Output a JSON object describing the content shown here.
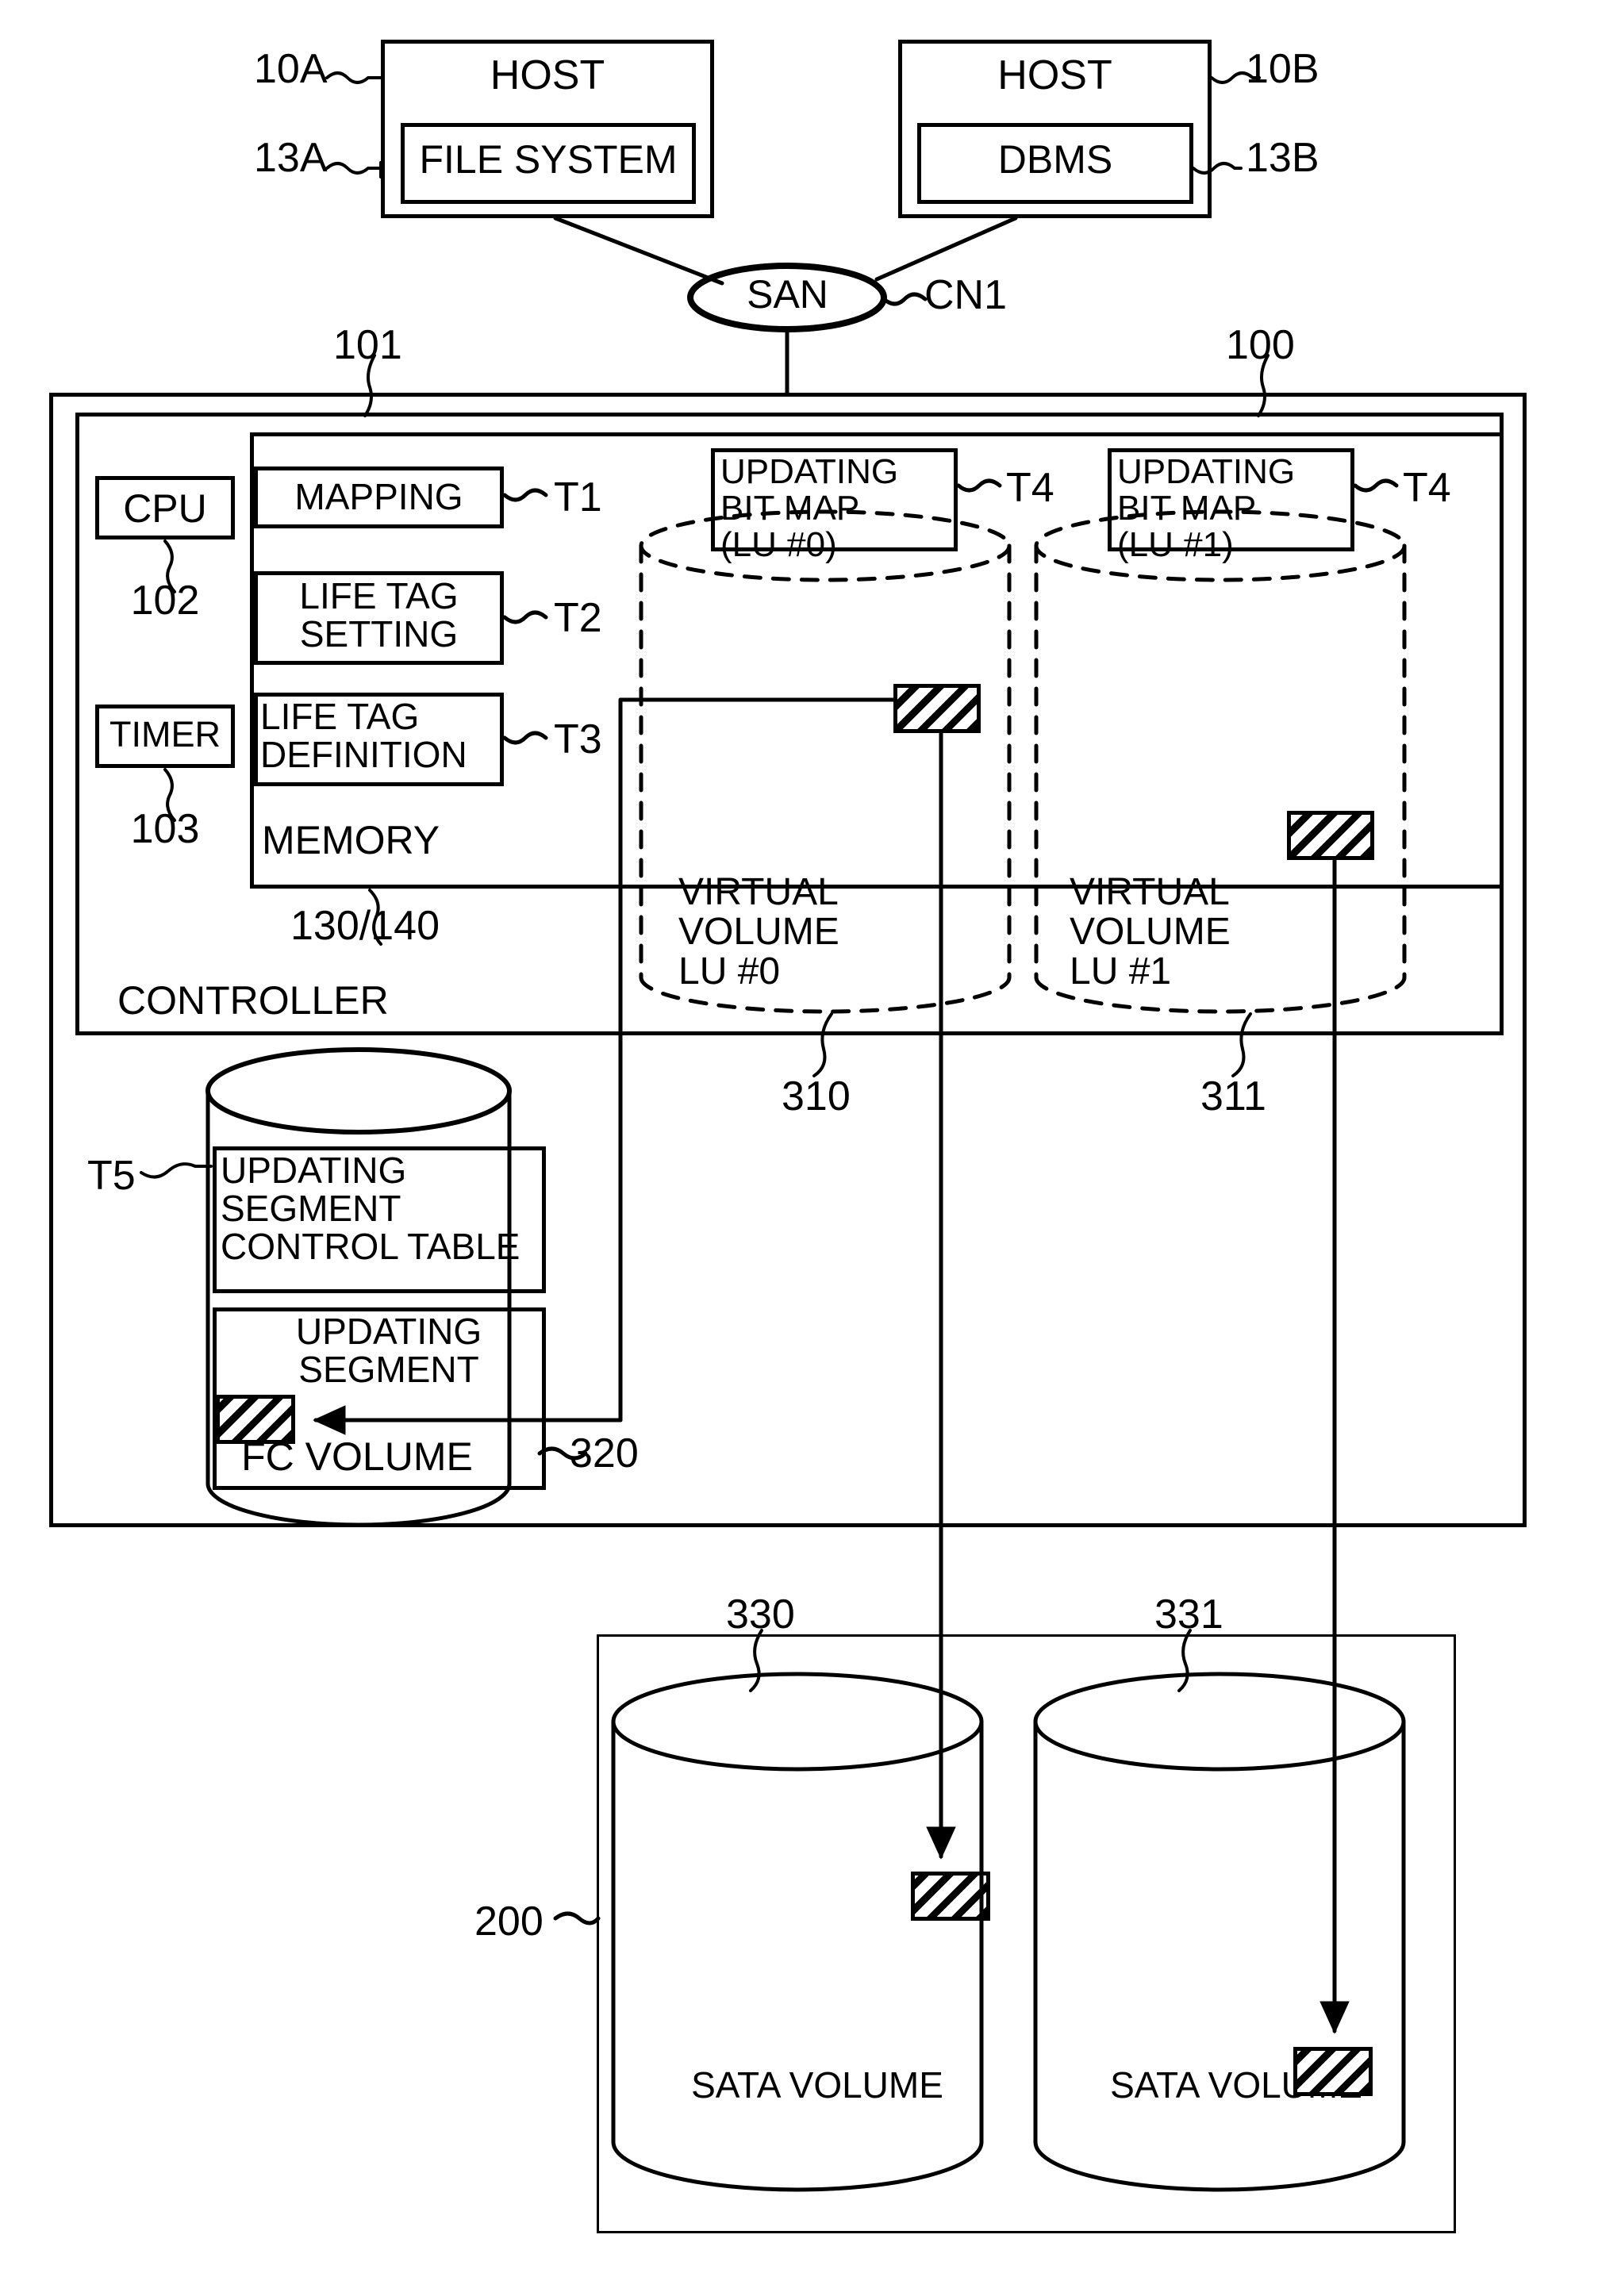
{
  "figure": {
    "domain_kind": "patent-block-diagram",
    "ink_color": "#000000",
    "background_color": "#ffffff"
  },
  "hosts": [
    {
      "ref": "10A",
      "title": "HOST",
      "inner_ref": "13A",
      "inner_title": "FILE SYSTEM"
    },
    {
      "ref": "10B",
      "title": "HOST",
      "inner_ref": "13B",
      "inner_title": "DBMS"
    }
  ],
  "network": {
    "label": "SAN",
    "ref": "CN1"
  },
  "storage_system": {
    "ref": "100",
    "controller": {
      "ref": "101",
      "label": "CONTROLLER",
      "cpu": {
        "label": "CPU",
        "ref": "102"
      },
      "timer": {
        "label": "TIMER",
        "ref": "103"
      },
      "memory": {
        "label": "MEMORY",
        "ref": "130/140",
        "tables": [
          {
            "label": "MAPPING",
            "ref": "T1"
          },
          {
            "label": "LIFE TAG\nSETTING",
            "ref": "T2"
          },
          {
            "label": "LIFE TAG\nDEFINITION",
            "ref": "T3"
          }
        ]
      }
    },
    "virtual_volumes": [
      {
        "bitmap_label": "UPDATING\nBIT MAP\n(LU #0)",
        "bitmap_ref": "T4",
        "volume_label": "VIRTUAL\nVOLUME\nLU #0",
        "ref": "310"
      },
      {
        "bitmap_label": "UPDATING\nBIT MAP\n(LU #1)",
        "bitmap_ref": "T4",
        "volume_label": "VIRTUAL\nVOLUME\nLU #1",
        "ref": "311"
      }
    ],
    "fc_volume": {
      "label": "FC VOLUME",
      "ref": "320",
      "control_table": {
        "label": "UPDATING\nSEGMENT\nCONTROL TABLE",
        "ref": "T5"
      },
      "segment": {
        "label": "UPDATING\nSEGMENT"
      }
    }
  },
  "disk_enclosure": {
    "ref": "200",
    "volumes": [
      {
        "label": "SATA VOLUME",
        "ref": "330"
      },
      {
        "label": "SATA VOLUME",
        "ref": "331"
      }
    ]
  }
}
